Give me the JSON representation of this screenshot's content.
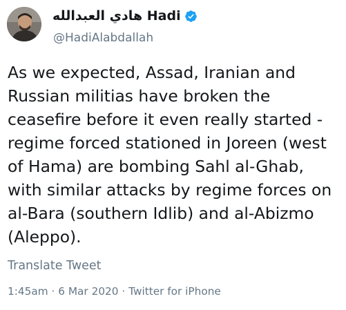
{
  "user": {
    "display_name": "هادي العبدالله Hadi",
    "handle": "@HadiAlabdallah",
    "verified": true,
    "verified_icon": "verified-badge-icon",
    "avatar_icon": "profile-photo"
  },
  "tweet": {
    "text": "As we expected, Assad, Iranian and\nRussian militias have broken the\nceasefire before it even really started -\nregime forced stationed in Joreen (west\nof Hama) are bombing Sahl al-Ghab,\nwith similar attacks by regime forces on\nal-Bara (southern Idlib) and al-Abizmo\n(Aleppo).",
    "translate_label": "Translate Tweet",
    "time": "1:45am",
    "date": "6 Mar 2020",
    "source": "Twitter for iPhone",
    "separator": "·"
  },
  "colors": {
    "text": "#14171a",
    "secondary": "#657786",
    "verified": "#1da1f2",
    "background": "#ffffff"
  }
}
